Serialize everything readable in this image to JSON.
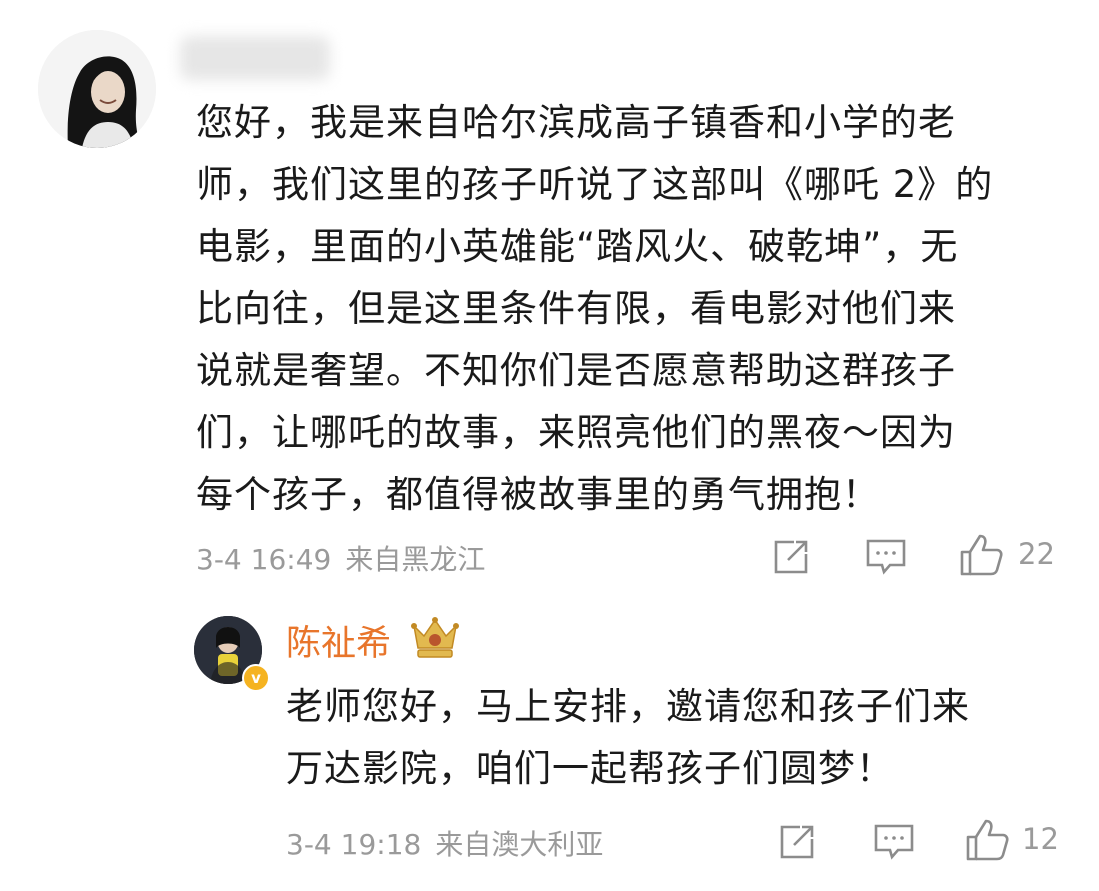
{
  "comment": {
    "text": "您好，我是来自哈尔滨成高子镇香和小学的老\n师，我们这里的孩子听说了这部叫《哪吒 2》的\n电影，里面的小英雄能“踏风火、破乾坤”，无\n比向往，但是这里条件有限，看电影对他们来\n说就是奢望。不知你们是否愿意帮助这群孩子\n们，让哪吒的故事，来照亮他们的黑夜～因为\n每个孩子，都值得被故事里的勇气拥抱！",
    "time": "3-4 16:49",
    "location": "来自黑龙江",
    "likes": "22",
    "icons": {
      "share": "share-icon",
      "reply": "comment-icon",
      "like": "thumbs-up-icon"
    }
  },
  "reply": {
    "username": "陈祉希",
    "text": "老师您好，马上安排，邀请您和孩子们来\n万达影院，咱们一起帮孩子们圆梦！",
    "time": "3-4 19:18",
    "location": "来自澳大利亚",
    "likes": "12",
    "name_color": "#e8752b",
    "badge_color": "#f5b321",
    "icons": {
      "crown": "crown-icon",
      "verified": "verified-icon"
    }
  }
}
